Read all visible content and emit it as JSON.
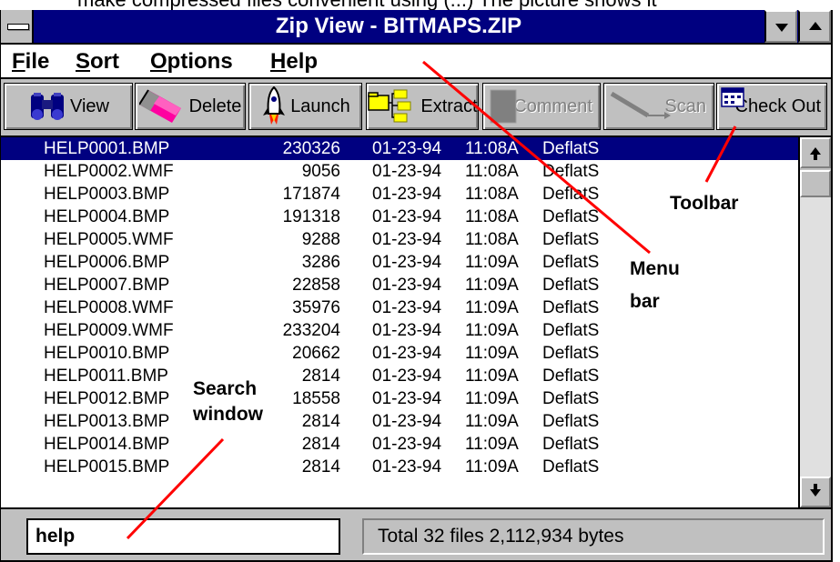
{
  "top_text": "make compressed files convenient using (...) The picture shows it",
  "window": {
    "title": "Zip View - BITMAPS.ZIP"
  },
  "menu": {
    "items": [
      "File",
      "Sort",
      "Options",
      "Help"
    ]
  },
  "toolbar": {
    "buttons": [
      {
        "label": "View",
        "icon": "binoculars-icon",
        "enabled": true
      },
      {
        "label": "Delete",
        "icon": "eraser-icon",
        "enabled": true
      },
      {
        "label": "Launch",
        "icon": "rocket-icon",
        "enabled": true
      },
      {
        "label": "Extract",
        "icon": "folder-tree-icon",
        "enabled": true
      },
      {
        "label": "Comment",
        "icon": "comment-icon",
        "enabled": false
      },
      {
        "label": "Scan",
        "icon": "scan-probe-icon",
        "enabled": false
      },
      {
        "label": "Check Out",
        "icon": "calendar-icon",
        "enabled": true
      }
    ]
  },
  "files": [
    {
      "name": "HELP0001.BMP",
      "size": "230326",
      "date": "01-23-94",
      "time": "11:08A",
      "method": "DeflatS",
      "selected": true
    },
    {
      "name": "HELP0002.WMF",
      "size": "9056",
      "date": "01-23-94",
      "time": "11:08A",
      "method": "DeflatS"
    },
    {
      "name": "HELP0003.BMP",
      "size": "171874",
      "date": "01-23-94",
      "time": "11:08A",
      "method": "DeflatS"
    },
    {
      "name": "HELP0004.BMP",
      "size": "191318",
      "date": "01-23-94",
      "time": "11:08A",
      "method": "DeflatS"
    },
    {
      "name": "HELP0005.WMF",
      "size": "9288",
      "date": "01-23-94",
      "time": "11:08A",
      "method": "DeflatS"
    },
    {
      "name": "HELP0006.BMP",
      "size": "3286",
      "date": "01-23-94",
      "time": "11:09A",
      "method": "DeflatS"
    },
    {
      "name": "HELP0007.BMP",
      "size": "22858",
      "date": "01-23-94",
      "time": "11:09A",
      "method": "DeflatS"
    },
    {
      "name": "HELP0008.WMF",
      "size": "35976",
      "date": "01-23-94",
      "time": "11:09A",
      "method": "DeflatS"
    },
    {
      "name": "HELP0009.WMF",
      "size": "233204",
      "date": "01-23-94",
      "time": "11:09A",
      "method": "DeflatS"
    },
    {
      "name": "HELP0010.BMP",
      "size": "20662",
      "date": "01-23-94",
      "time": "11:09A",
      "method": "DeflatS"
    },
    {
      "name": "HELP0011.BMP",
      "size": "2814",
      "date": "01-23-94",
      "time": "11:09A",
      "method": "DeflatS"
    },
    {
      "name": "HELP0012.BMP",
      "size": "18558",
      "date": "01-23-94",
      "time": "11:09A",
      "method": "DeflatS"
    },
    {
      "name": "HELP0013.BMP",
      "size": "2814",
      "date": "01-23-94",
      "time": "11:09A",
      "method": "DeflatS"
    },
    {
      "name": "HELP0014.BMP",
      "size": "2814",
      "date": "01-23-94",
      "time": "11:09A",
      "method": "DeflatS"
    },
    {
      "name": "HELP0015.BMP",
      "size": "2814",
      "date": "01-23-94",
      "time": "11:09A",
      "method": "DeflatS"
    }
  ],
  "search": {
    "value": "help"
  },
  "status": {
    "text": "Total 32 files  2,112,934 bytes"
  },
  "annotations": {
    "toolbar": "Toolbar",
    "menu_bar_line1": "Menu",
    "menu_bar_line2": "bar",
    "search_window_line1": "Search",
    "search_window_line2": "window",
    "arrow_color": "#ff0000"
  },
  "colors": {
    "title_bar": "#000080",
    "selection": "#000080",
    "face": "#c0c0c0"
  }
}
